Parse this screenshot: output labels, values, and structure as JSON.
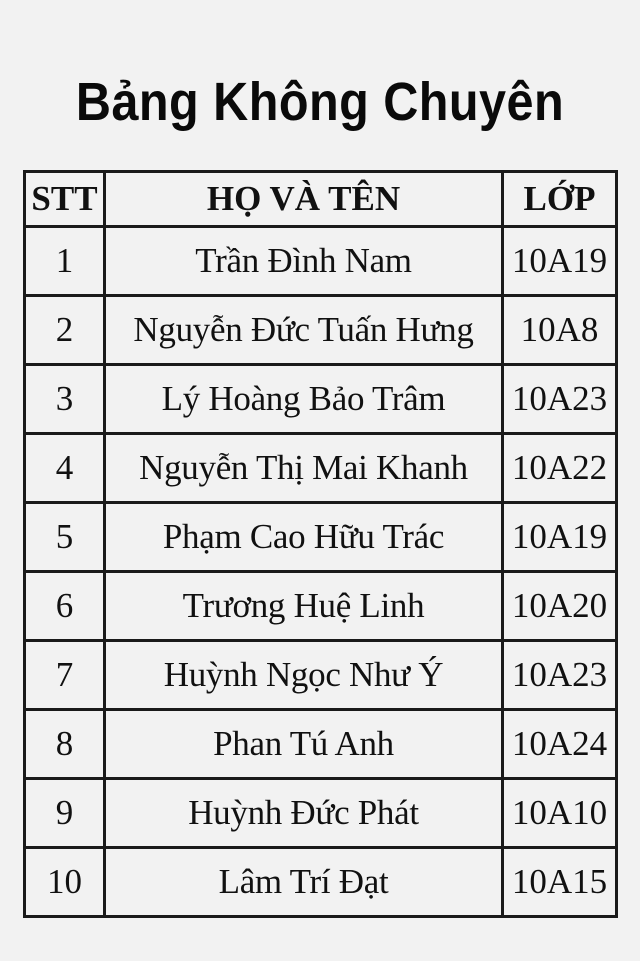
{
  "title": "Bảng Không Chuyên",
  "table": {
    "headers": {
      "stt": "STT",
      "name": "HỌ VÀ TÊN",
      "class": "LỚP"
    },
    "rows": [
      {
        "stt": "1",
        "name": "Trần Đình Nam",
        "class": "10A19"
      },
      {
        "stt": "2",
        "name": "Nguyễn Đức Tuấn Hưng",
        "class": "10A8"
      },
      {
        "stt": "3",
        "name": "Lý Hoàng Bảo Trâm",
        "class": "10A23"
      },
      {
        "stt": "4",
        "name": "Nguyễn Thị Mai Khanh",
        "class": "10A22"
      },
      {
        "stt": "5",
        "name": "Phạm Cao Hữu Trác",
        "class": "10A19"
      },
      {
        "stt": "6",
        "name": "Trương Huệ Linh",
        "class": "10A20"
      },
      {
        "stt": "7",
        "name": "Huỳnh Ngọc Như Ý",
        "class": "10A23"
      },
      {
        "stt": "8",
        "name": "Phan Tú Anh",
        "class": "10A24"
      },
      {
        "stt": "9",
        "name": "Huỳnh Đức Phát",
        "class": "10A10"
      },
      {
        "stt": "10",
        "name": "Lâm Trí Đạt",
        "class": "10A15"
      }
    ]
  }
}
